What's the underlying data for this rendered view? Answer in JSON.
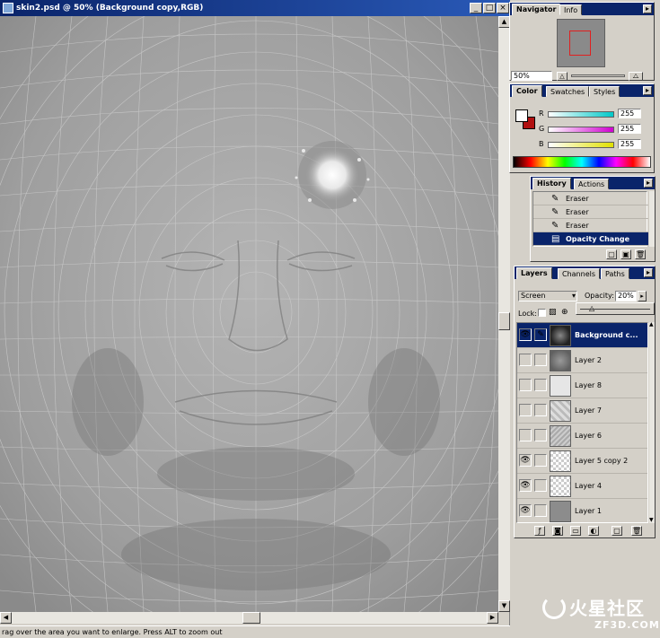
{
  "document": {
    "title": "skin2.psd @ 50% (Background copy,RGB)",
    "status_text": "rag over the area you want to enlarge. Press ALT to zoom out"
  },
  "navigator": {
    "tabs": [
      "Navigator",
      "Info"
    ],
    "zoom": "50%"
  },
  "color": {
    "tabs": [
      "Color",
      "Swatches",
      "Styles"
    ],
    "channels": [
      {
        "label": "R",
        "value": "255",
        "color": "#00c8c8"
      },
      {
        "label": "G",
        "value": "255",
        "color": "#d000d0"
      },
      {
        "label": "B",
        "value": "255",
        "color": "#e0e000"
      }
    ],
    "foreground": "#ffffff",
    "background": "#b01010"
  },
  "history": {
    "tabs": [
      "History",
      "Actions"
    ],
    "items": [
      {
        "label": "Eraser",
        "selected": false
      },
      {
        "label": "Eraser",
        "selected": false
      },
      {
        "label": "Eraser",
        "selected": false
      },
      {
        "label": "Opacity Change",
        "selected": true
      }
    ]
  },
  "layers": {
    "tabs": [
      "Layers",
      "Channels",
      "Paths"
    ],
    "blend_mode": "Screen",
    "opacity_label": "Opacity:",
    "opacity_value": "20%",
    "lock_label": "Lock:",
    "items": [
      {
        "name": "Background c...",
        "visible": true,
        "selected": true
      },
      {
        "name": "Layer 2",
        "visible": false,
        "selected": false
      },
      {
        "name": "Layer 8",
        "visible": false,
        "selected": false
      },
      {
        "name": "Layer 7",
        "visible": false,
        "selected": false
      },
      {
        "name": "Layer 6",
        "visible": false,
        "selected": false
      },
      {
        "name": "Layer 5 copy 2",
        "visible": true,
        "selected": false
      },
      {
        "name": "Layer 4",
        "visible": true,
        "selected": false
      },
      {
        "name": "Layer 1",
        "visible": true,
        "selected": false
      }
    ]
  },
  "watermark": {
    "text": "火星社区",
    "url": "ZF3D.COM"
  }
}
